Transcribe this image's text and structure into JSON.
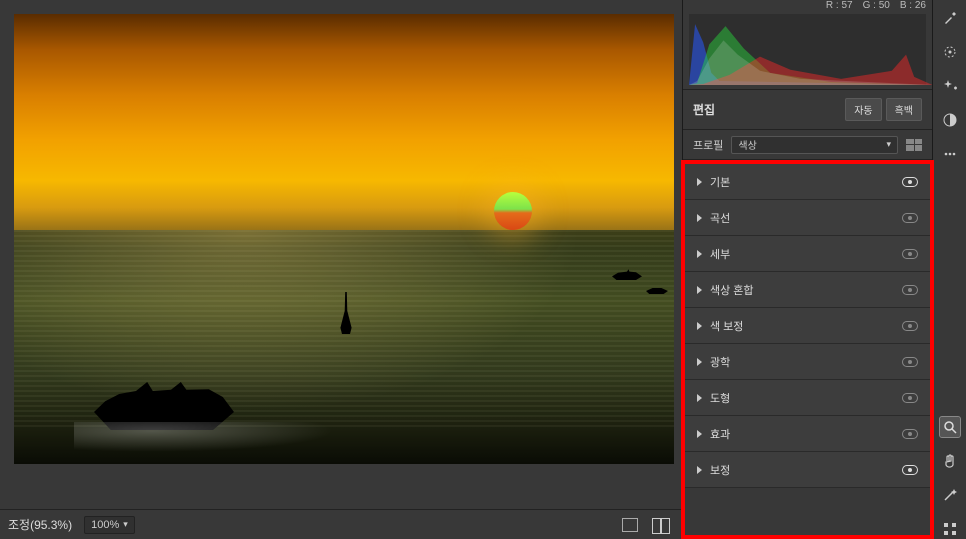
{
  "histogram_readout": {
    "r": "R : 57",
    "g": "G : 50",
    "b": "B : 26"
  },
  "edit_header": {
    "label": "편집",
    "auto_btn": "자동",
    "bw_btn": "흑백"
  },
  "profile_row": {
    "label": "프로필",
    "selected": "색상"
  },
  "accordion": [
    {
      "label": "기본",
      "active_eye": true
    },
    {
      "label": "곡선",
      "active_eye": false
    },
    {
      "label": "세부",
      "active_eye": false
    },
    {
      "label": "색상 혼합",
      "active_eye": false
    },
    {
      "label": "색 보정",
      "active_eye": false
    },
    {
      "label": "광학",
      "active_eye": false
    },
    {
      "label": "도형",
      "active_eye": false
    },
    {
      "label": "효과",
      "active_eye": false
    },
    {
      "label": "보정",
      "active_eye": true
    }
  ],
  "status_bar": {
    "adjust_label": "조정(95.3%)",
    "zoom": "100%"
  },
  "right_tools": [
    "eyedropper-icon",
    "target-icon",
    "sparkle-plus-icon",
    "gradient-icon",
    "more-icon",
    "zoom-icon",
    "hand-icon",
    "wand-icon",
    "grid-icon"
  ]
}
